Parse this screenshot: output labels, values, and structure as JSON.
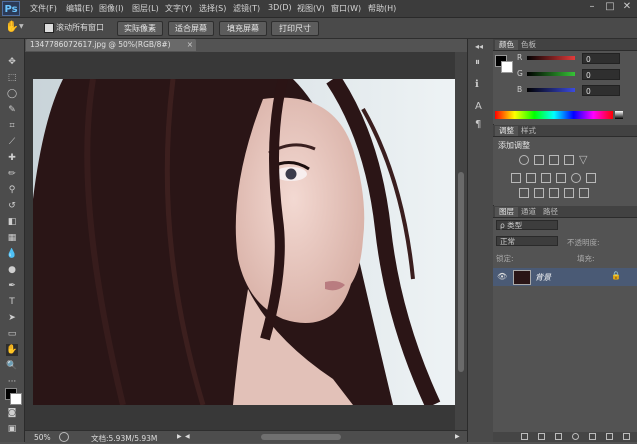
{
  "menubar": {
    "logo": "Ps",
    "items": [
      "文件(F)",
      "编辑(E)",
      "图像(I)",
      "图层(L)",
      "文字(Y)",
      "选择(S)",
      "滤镜(T)",
      "3D(D)",
      "视图(V)",
      "窗口(W)",
      "帮助(H)"
    ],
    "minimize": "–",
    "maximize": "□",
    "close": "✕"
  },
  "options": {
    "scroll_all_label": "滚动所有窗口",
    "actual_pixels": "实际像素",
    "fit_screen": "适合屏幕",
    "fill_screen": "填充屏幕",
    "print_size": "打印尺寸"
  },
  "document": {
    "tab_title": "1347786072617.jpg @ 50%(RGB/8#)",
    "tab_close": "×"
  },
  "status": {
    "zoom": "50%",
    "doc_info": "文档:5.93M/5.93M"
  },
  "color_panel": {
    "tabs": [
      "颜色",
      "色板"
    ],
    "channels": [
      {
        "label": "R",
        "value": "0",
        "color": "#e23b3b"
      },
      {
        "label": "G",
        "value": "0",
        "color": "#36c236"
      },
      {
        "label": "B",
        "value": "0",
        "color": "#3b4be0"
      }
    ]
  },
  "adjust_panel": {
    "tabs": [
      "调整",
      "样式"
    ],
    "title": "添加调整"
  },
  "layers_panel": {
    "tabs": [
      "图层",
      "通道",
      "路径"
    ],
    "filter_kind": "ρ 类型",
    "blend_mode": "正常",
    "opacity_label": "不透明度:",
    "lock_label": "锁定:",
    "fill_label": "填充:",
    "layer_name": "背景"
  },
  "colors": {
    "accent": "#4a5a75",
    "ps_blue": "#6cc6ff"
  }
}
